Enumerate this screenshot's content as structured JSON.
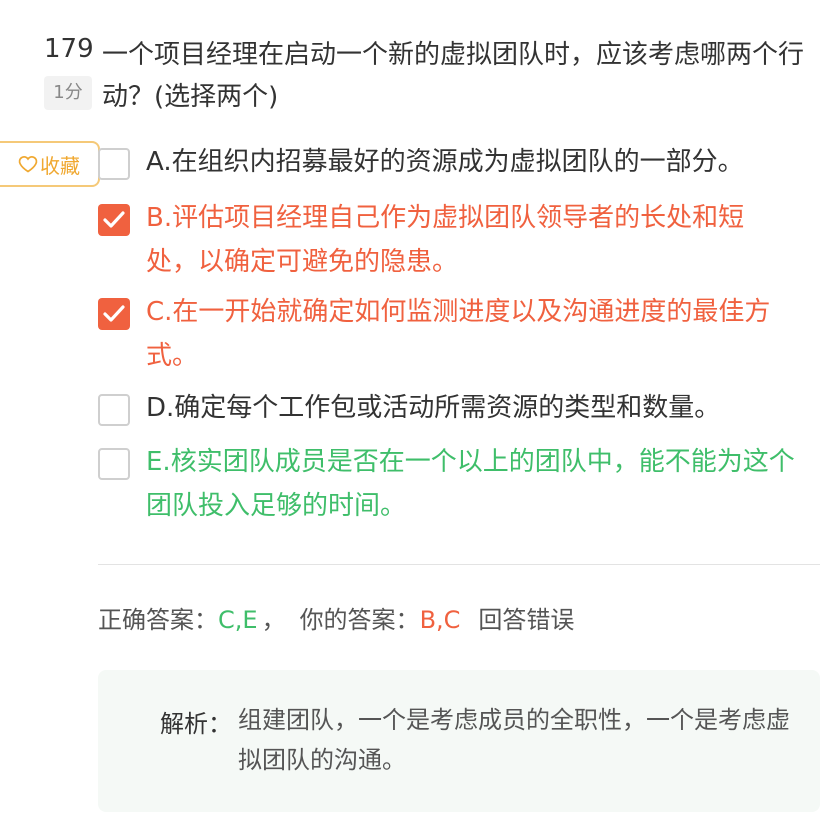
{
  "question": {
    "number": "179",
    "text": "一个项目经理在启动一个新的虚拟团队时，应该考虑哪两个行动？(选择两个)",
    "score": "1分"
  },
  "favorite": {
    "label": "收藏"
  },
  "options": [
    {
      "letter": "A.",
      "text": "在组织内招募最好的资源成为虚拟团队的一部分。",
      "checked": false,
      "state": "normal"
    },
    {
      "letter": "B.",
      "text": "评估项目经理自己作为虚拟团队领导者的长处和短处，以确定可避免的隐患。",
      "checked": true,
      "state": "wrong"
    },
    {
      "letter": "C.",
      "text": "在一开始就确定如何监测进度以及沟通进度的最佳方式。",
      "checked": true,
      "state": "wrong"
    },
    {
      "letter": "D.",
      "text": "确定每个工作包或活动所需资源的类型和数量。",
      "checked": false,
      "state": "normal"
    },
    {
      "letter": "E.",
      "text": "核实团队成员是否在一个以上的团队中，能不能为这个团队投入足够的时间。",
      "checked": false,
      "state": "correct"
    }
  ],
  "result": {
    "correct_label": "正确答案：",
    "correct_value": "C,E",
    "separator": "，",
    "yours_label": "你的答案：",
    "yours_value": "B,C",
    "status": "回答错误"
  },
  "explanation": {
    "label": "解析：",
    "text": "组建团队，一个是考虑成员的全职性，一个是考虑虚拟团队的沟通。"
  },
  "colors": {
    "wrong": "#f0613f",
    "correct": "#3fbe6a",
    "accent": "#f0a830"
  }
}
